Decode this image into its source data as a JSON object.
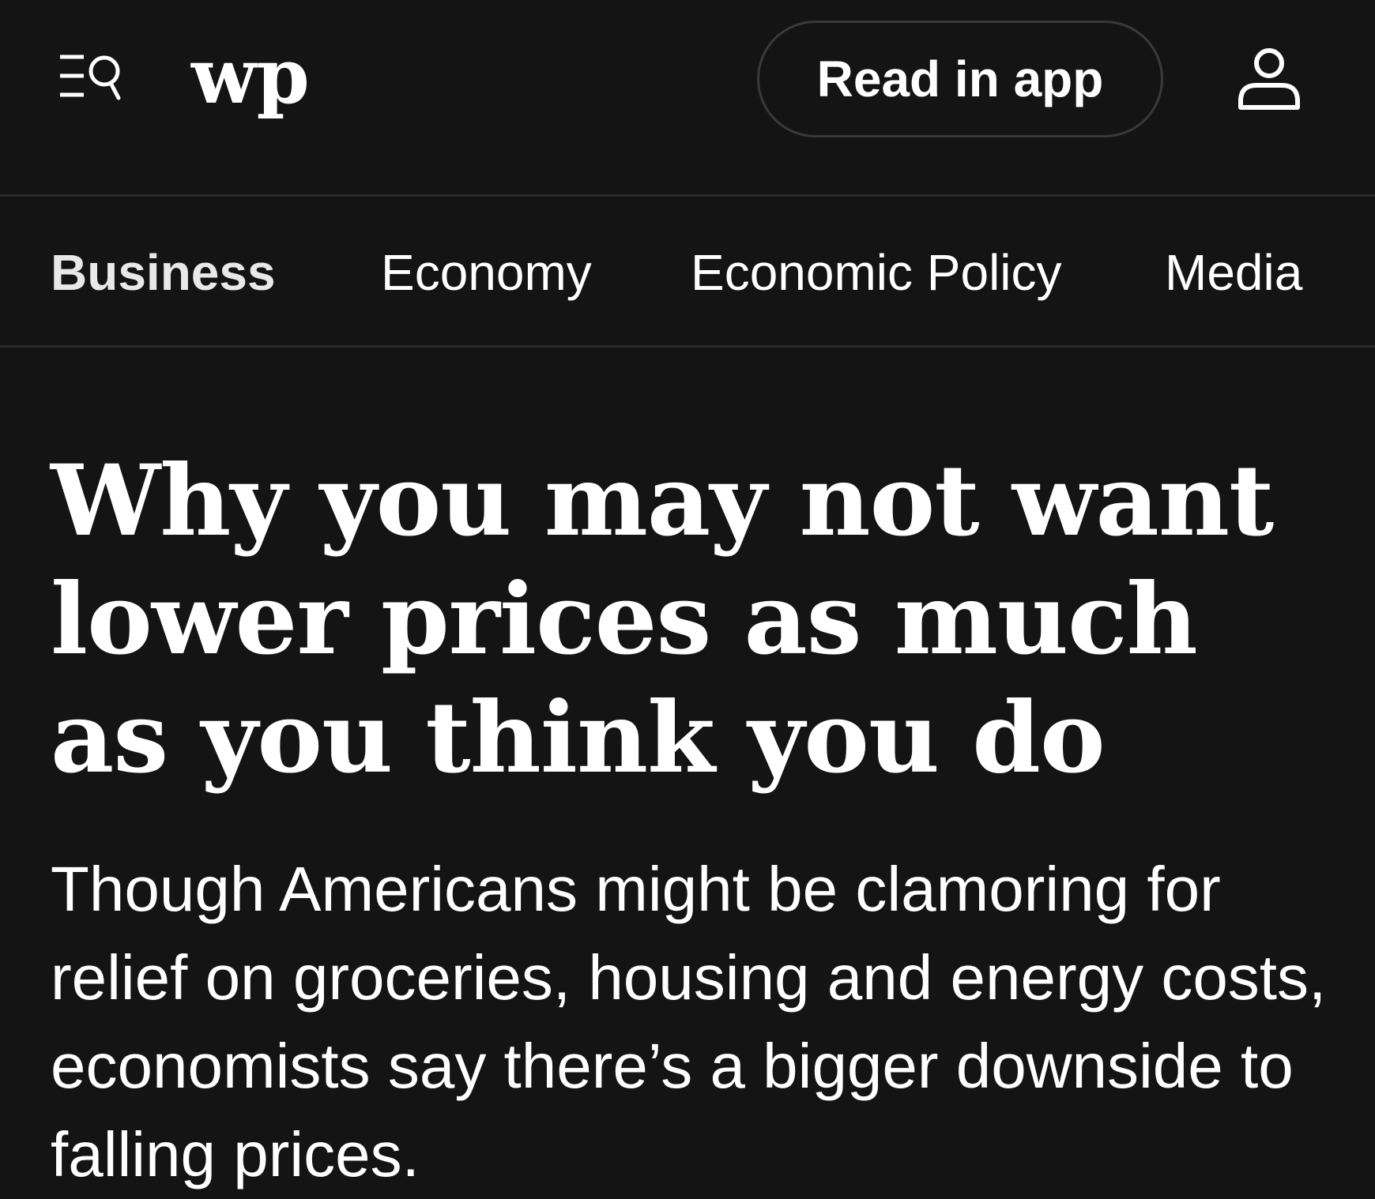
{
  "header": {
    "read_in_app_label": "Read in app",
    "logo_text": "wp"
  },
  "sections": [
    {
      "label": "Business",
      "active": true
    },
    {
      "label": "Economy",
      "active": false
    },
    {
      "label": "Economic Policy",
      "active": false
    },
    {
      "label": "Media",
      "active": false
    }
  ],
  "article": {
    "headline": "Why you may not want lower prices as much as you think you do",
    "dek": "Though Americans might be clamoring for relief on groceries, housing and energy costs, economists say there’s a bigger downside to falling prices."
  },
  "icons": {
    "menu": "menu-search-icon",
    "logo": "wp-logo-icon",
    "account": "account-icon"
  },
  "colors": {
    "background": "#141414",
    "text": "#ffffff",
    "divider": "#2b2b2b",
    "button_border": "#3a3a3a"
  }
}
